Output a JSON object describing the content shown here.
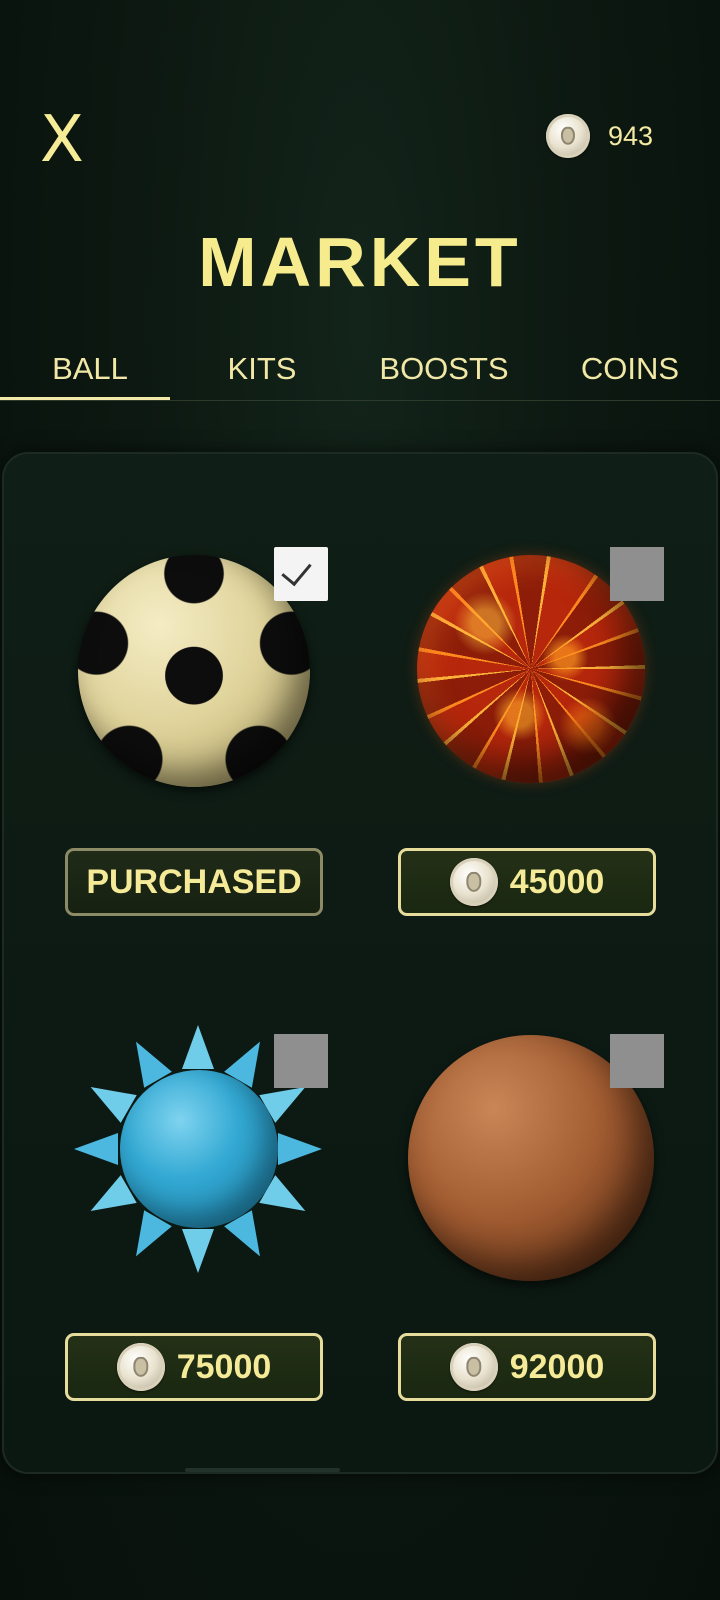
{
  "header": {
    "close_label": "X",
    "balance": "943",
    "title": "MARKET"
  },
  "tabs": [
    {
      "label": "BALL",
      "active": true
    },
    {
      "label": "KITS",
      "active": false
    },
    {
      "label": "BOOSTS",
      "active": false
    },
    {
      "label": "COINS",
      "active": false
    }
  ],
  "items": [
    {
      "name": "soccer-ball",
      "selected": true,
      "button_label": "PURCHASED",
      "price": null
    },
    {
      "name": "lava-ball",
      "selected": false,
      "button_label": "45000",
      "price": "45000"
    },
    {
      "name": "spiky-ball",
      "selected": false,
      "button_label": "75000",
      "price": "75000"
    },
    {
      "name": "clay-ball",
      "selected": false,
      "button_label": "92000",
      "price": "92000"
    }
  ],
  "colors": {
    "accent": "#f6ec8e",
    "background": "#0c1811",
    "button_border": "#e6dc9b"
  },
  "icons": {
    "close": "close-icon",
    "coin": "coin-icon",
    "check": "check-icon"
  }
}
